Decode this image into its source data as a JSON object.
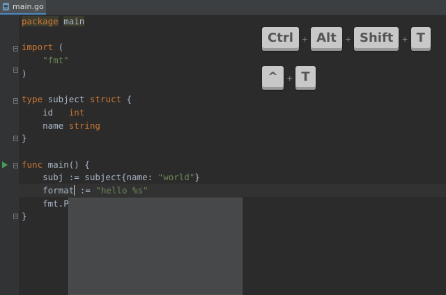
{
  "editor": {
    "tab_label": "main.go",
    "lines": [
      [
        {
          "t": "package",
          "c": "kw hl-pkg"
        },
        {
          "t": " "
        },
        {
          "t": "main",
          "c": "hl-pkg"
        }
      ],
      [],
      [
        {
          "t": "import",
          "c": "kw"
        },
        {
          "t": " ("
        }
      ],
      [
        {
          "t": "    "
        },
        {
          "t": "\"fmt\"",
          "c": "str"
        }
      ],
      [
        {
          "t": ")"
        }
      ],
      [],
      [
        {
          "t": "type",
          "c": "kw"
        },
        {
          "t": " subject "
        },
        {
          "t": "struct",
          "c": "kw"
        },
        {
          "t": " {"
        }
      ],
      [
        {
          "t": "    id   "
        },
        {
          "t": "int",
          "c": "tp"
        }
      ],
      [
        {
          "t": "    name "
        },
        {
          "t": "string",
          "c": "tp"
        }
      ],
      [
        {
          "t": "}"
        }
      ],
      [],
      [
        {
          "t": "func",
          "c": "kw"
        },
        {
          "t": " main() {"
        }
      ],
      [
        {
          "t": "    subj := subject{name: "
        },
        {
          "t": "\"world\"",
          "c": "str"
        },
        {
          "t": "}"
        }
      ],
      [
        {
          "t": "    format"
        },
        {
          "caret": true
        },
        {
          "t": " := "
        },
        {
          "t": "\"hello %s\"",
          "c": "str"
        }
      ],
      [
        {
          "t": "    fmt.Pr"
        }
      ],
      [
        {
          "t": "}"
        }
      ]
    ]
  },
  "shortcuts": {
    "row1": [
      "Ctrl",
      "Alt",
      "Shift",
      "T"
    ],
    "row2": [
      "^",
      "T"
    ],
    "plus": "+"
  },
  "colors": {
    "background": "#2b2b2b",
    "keyword": "#cc7832",
    "string": "#6a8759",
    "text": "#a9b7c6"
  }
}
